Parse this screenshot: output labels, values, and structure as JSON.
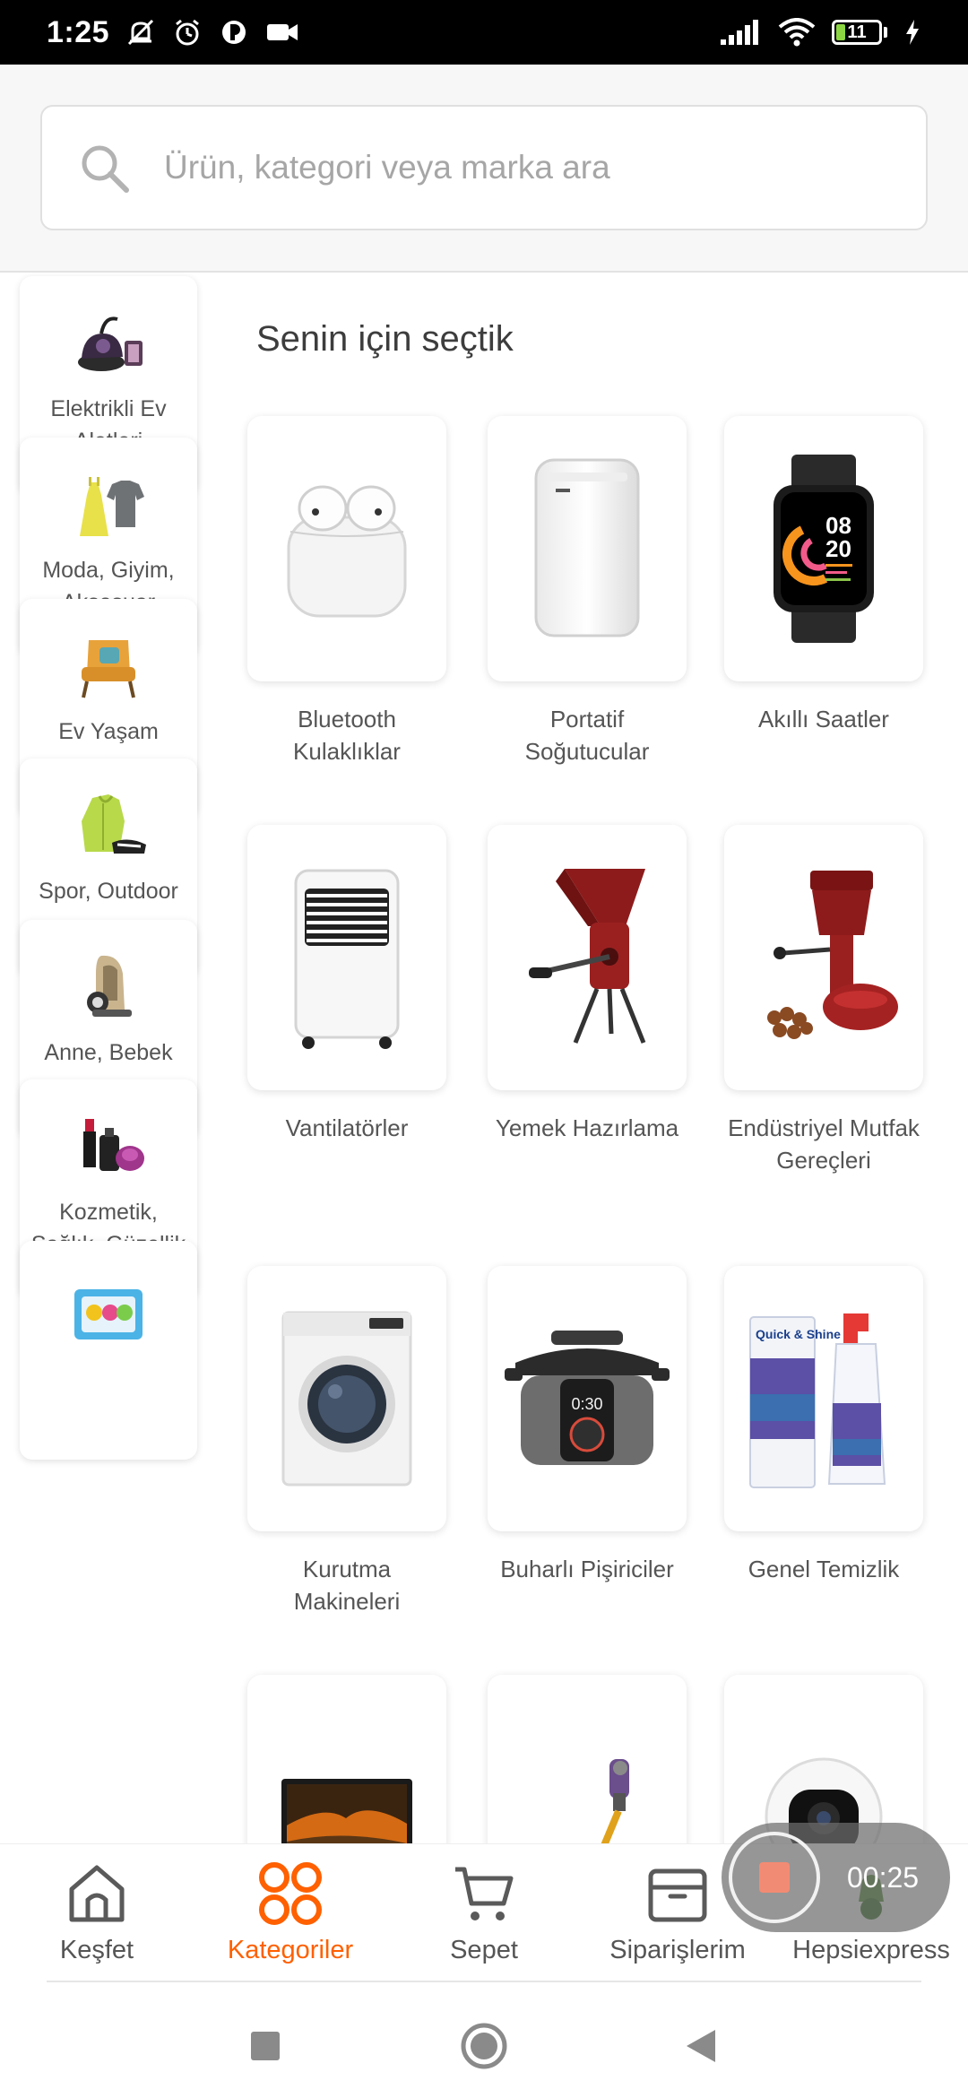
{
  "status_bar": {
    "time": "1:25",
    "battery": "11"
  },
  "search": {
    "placeholder": "Ürün, kategori veya marka ara"
  },
  "categories": [
    {
      "label": "Elektrikli Ev Aletleri",
      "icon": "vacuum-icon"
    },
    {
      "label": "Moda, Giyim, Aksesuar",
      "icon": "clothing-icon"
    },
    {
      "label": "Ev Yaşam",
      "icon": "armchair-icon"
    },
    {
      "label": "Spor, Outdoor",
      "icon": "jacket-icon"
    },
    {
      "label": "Anne, Bebek",
      "icon": "baby-seat-icon"
    },
    {
      "label": "Kozmetik, Sağlık, Güzellik",
      "icon": "cosmetics-icon"
    },
    {
      "label": "",
      "icon": "grocery-icon"
    }
  ],
  "main": {
    "section_title": "Senin için seçtik",
    "products": [
      {
        "label": "Bluetooth Kulaklıklar",
        "icon": "earbuds-icon"
      },
      {
        "label": "Portatif Soğutucular",
        "icon": "portable-ac-icon"
      },
      {
        "label": "Akıllı Saatler",
        "icon": "smartwatch-icon",
        "watch_hour": "08",
        "watch_min": "20"
      },
      {
        "label": "Vantilatörler",
        "icon": "air-cooler-icon"
      },
      {
        "label": "Yemek Hazırlama",
        "icon": "grinder-icon"
      },
      {
        "label": "Endüstriyel Mutfak Gereçleri",
        "icon": "roaster-icon"
      },
      {
        "label": "Kurutma Makineleri",
        "icon": "dryer-icon"
      },
      {
        "label": "Buharlı Pişiriciler",
        "icon": "pressure-cooker-icon",
        "display": "0:30"
      },
      {
        "label": "Genel Temizlik",
        "icon": "cleaning-spray-icon",
        "brand": "Quick & Shine"
      },
      {
        "label": "",
        "icon": "laptop-icon"
      },
      {
        "label": "",
        "icon": "stick-vacuum-icon"
      },
      {
        "label": "",
        "icon": "security-camera-icon"
      }
    ]
  },
  "bottom_nav": {
    "items": [
      {
        "label": "Keşfet",
        "icon": "home-icon"
      },
      {
        "label": "Kategoriler",
        "icon": "categories-icon",
        "active": true
      },
      {
        "label": "Sepet",
        "icon": "cart-icon"
      },
      {
        "label": "Siparişlerim",
        "icon": "box-icon"
      },
      {
        "label": "Hepsiexpress",
        "icon": "express-icon"
      }
    ]
  },
  "recording": {
    "time": "00:25"
  },
  "colors": {
    "accent": "#ff6000",
    "text": "#555555",
    "search_bg": "#f7f7f7"
  }
}
